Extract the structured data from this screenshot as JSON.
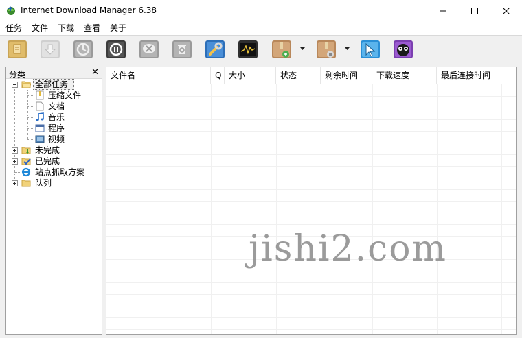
{
  "window": {
    "title": "Internet Download Manager 6.38"
  },
  "menu": {
    "items": [
      {
        "label": "任务"
      },
      {
        "label": "文件"
      },
      {
        "label": "下载"
      },
      {
        "label": "查看"
      },
      {
        "label": "关于"
      }
    ]
  },
  "toolbar": {
    "buttons": [
      {
        "icon": "add-url-icon"
      },
      {
        "icon": "resume-icon"
      },
      {
        "icon": "stop-icon"
      },
      {
        "icon": "stop-all-icon"
      },
      {
        "icon": "delete-icon"
      },
      {
        "icon": "delete-completed-icon"
      },
      {
        "icon": "options-icon"
      },
      {
        "icon": "scheduler-icon"
      },
      {
        "icon": "start-queue-icon"
      },
      {
        "icon": "stop-queue-icon"
      },
      {
        "icon": "grabber-icon"
      },
      {
        "icon": "tell-friend-icon"
      }
    ]
  },
  "categories": {
    "title": "分类",
    "close": "✕",
    "tree": {
      "all": "全部任务",
      "children": [
        "压缩文件",
        "文档",
        "音乐",
        "程序",
        "视频"
      ],
      "unfinished": "未完成",
      "finished": "已完成",
      "grabber": "站点抓取方案",
      "queues": "队列"
    }
  },
  "filelist": {
    "columns": [
      "文件名",
      "Q",
      "大小",
      "状态",
      "剩余时间",
      "下载速度",
      "最后连接时间"
    ]
  },
  "watermark": "jishi2.com",
  "colors": {
    "accent": "#0078d7",
    "toolbar_bg": "#f0f0f0"
  }
}
